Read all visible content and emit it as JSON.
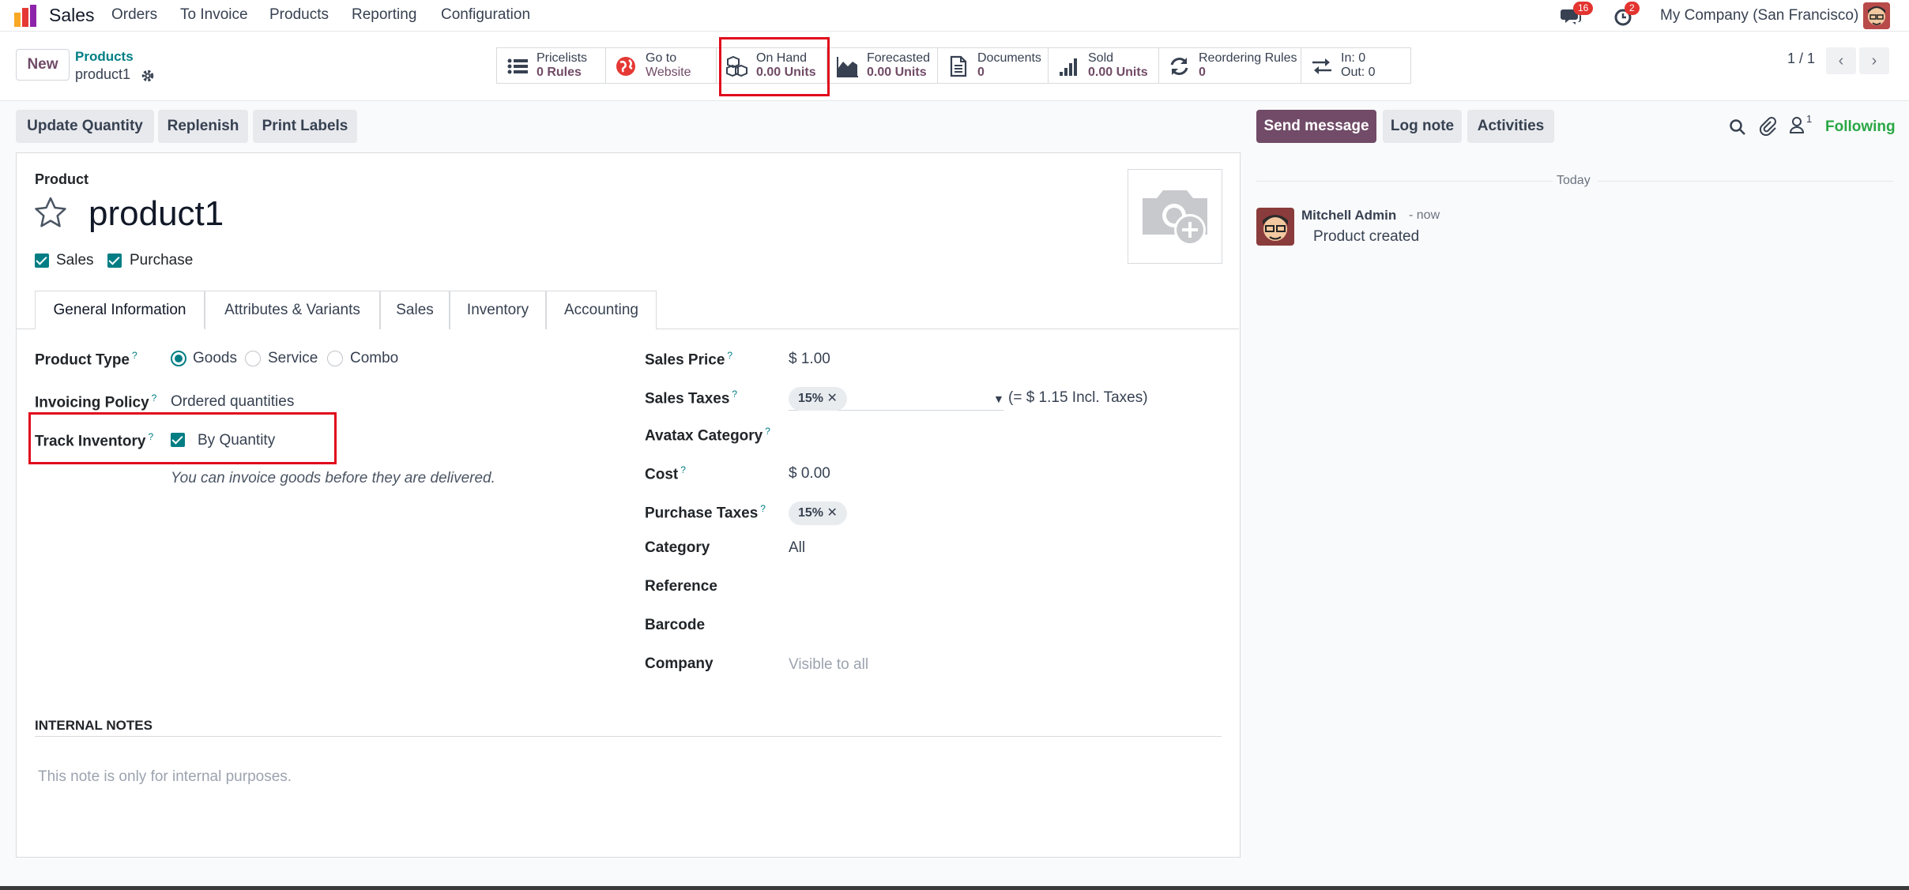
{
  "app": {
    "name": "Sales",
    "menus": [
      "Orders",
      "To Invoice",
      "Products",
      "Reporting",
      "Configuration"
    ],
    "messages_count": "16",
    "activities_count": "2",
    "company": "My Company (San Francisco)"
  },
  "control": {
    "new_label": "New",
    "breadcrumb_parent": "Products",
    "breadcrumb_current": "product1",
    "pager": "1 / 1"
  },
  "smart_buttons": [
    {
      "title": "Pricelists",
      "value": "0 Rules",
      "icon": "list-icon"
    },
    {
      "title": "Go to",
      "value": "Website",
      "icon": "globe-icon"
    },
    {
      "title": "On Hand",
      "value": "0.00 Units",
      "icon": "cubes-icon"
    },
    {
      "title": "Forecasted",
      "value": "0.00 Units",
      "icon": "area-chart-icon"
    },
    {
      "title": "Documents",
      "value": "0",
      "icon": "document-icon"
    },
    {
      "title": "Sold",
      "value": "0.00 Units",
      "icon": "signal-icon"
    },
    {
      "title": "Reordering Rules",
      "value": "0",
      "icon": "refresh-icon"
    },
    {
      "title": "In: 0",
      "value": "Out: 0",
      "icon": "exchange-icon"
    }
  ],
  "actions": {
    "update_quantity": "Update Quantity",
    "replenish": "Replenish",
    "print_labels": "Print Labels"
  },
  "chatter_actions": {
    "send_message": "Send message",
    "log_note": "Log note",
    "activities": "Activities",
    "followers_count": "1",
    "following": "Following"
  },
  "form": {
    "product_label": "Product",
    "product_name": "product1",
    "sales_check": "Sales",
    "purchase_check": "Purchase",
    "tabs": [
      "General Information",
      "Attributes & Variants",
      "Sales",
      "Inventory",
      "Accounting"
    ],
    "help_mark": "?",
    "left": {
      "product_type_label": "Product Type",
      "product_type_options": [
        "Goods",
        "Service",
        "Combo"
      ],
      "invoicing_policy_label": "Invoicing Policy",
      "invoicing_policy_value": "Ordered quantities",
      "track_inventory_label": "Track Inventory",
      "track_inventory_value": "By Quantity",
      "hint": "You can invoice goods before they are delivered."
    },
    "right": {
      "sales_price_label": "Sales Price",
      "sales_price_value": "$ 1.00",
      "sales_taxes_label": "Sales Taxes",
      "sales_taxes_tag": "15%",
      "sales_taxes_incl": "(= $ 1.15 Incl. Taxes)",
      "avatax_label": "Avatax Category",
      "cost_label": "Cost",
      "cost_value": "$ 0.00",
      "purchase_taxes_label": "Purchase Taxes",
      "purchase_taxes_tag": "15%",
      "category_label": "Category",
      "category_value": "All",
      "reference_label": "Reference",
      "barcode_label": "Barcode",
      "company_label": "Company",
      "company_placeholder": "Visible to all"
    },
    "internal_notes_label": "INTERNAL NOTES",
    "internal_notes_placeholder": "This note is only for internal purposes."
  },
  "chatter": {
    "date_separator": "Today",
    "author": "Mitchell Admin",
    "time": "- now",
    "message": "Product created"
  },
  "colors": {
    "brand": "#714b67",
    "accent": "#017e84",
    "highlight": "#e00b1c"
  }
}
